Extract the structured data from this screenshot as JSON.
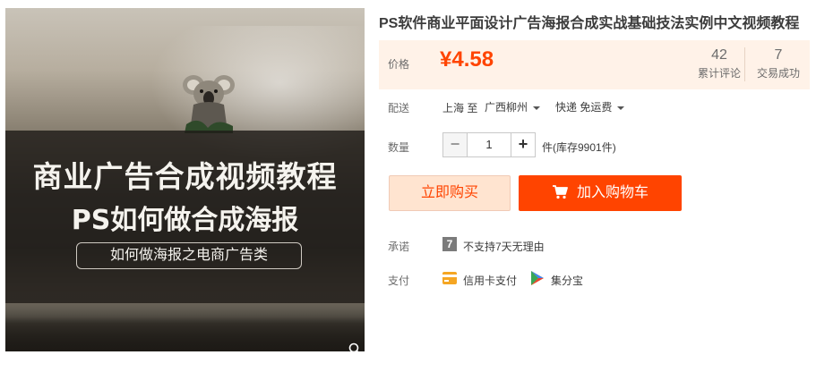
{
  "hero": {
    "headline": "商业广告合成视频教程",
    "subheadline": "PS如何做合成海报",
    "tagline": "如何做海报之电商广告类"
  },
  "product": {
    "title": "PS软件商业平面设计广告海报合成实战基础技法实例中文视频教程"
  },
  "price": {
    "label": "价格",
    "value": "¥4.58"
  },
  "stats": {
    "reviews_count": "42",
    "reviews_label": "累计评论",
    "deals_count": "7",
    "deals_label": "交易成功"
  },
  "delivery": {
    "label": "配送",
    "from": "上海 至",
    "to": "广西柳州",
    "shipping": "快递 免运费"
  },
  "quantity": {
    "label": "数量",
    "minus": "−",
    "value": "1",
    "plus": "+",
    "stock": "件(库存9901件)"
  },
  "actions": {
    "buy_now": "立即购买",
    "add_to_cart": "加入购物车"
  },
  "promise": {
    "label": "承诺",
    "badge": "7",
    "text": "不支持7天无理由"
  },
  "payment": {
    "label": "支付",
    "credit_card": "信用卡支付",
    "jifenbao": "集分宝"
  },
  "colors": {
    "accent": "#ff4400",
    "price_bg": "#fff2e8",
    "buy_now_bg": "#ffe4d0"
  }
}
